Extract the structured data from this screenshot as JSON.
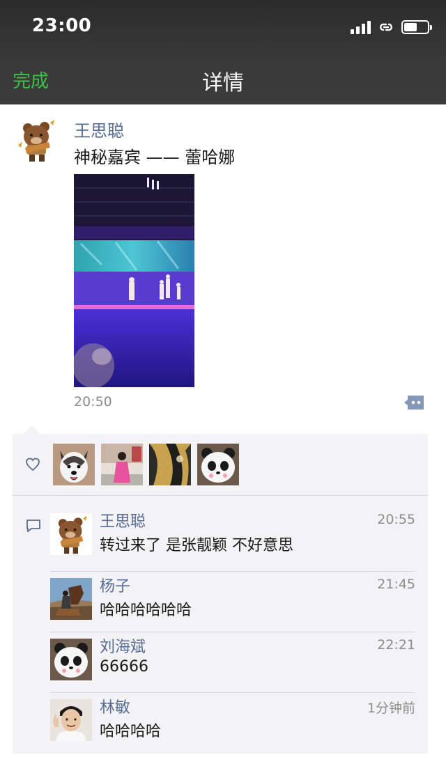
{
  "status_bar": {
    "time": "23:00",
    "icons": [
      "cellular-signal-icon",
      "hotspot-link-icon",
      "battery-icon"
    ],
    "battery_level": 0.55
  },
  "nav": {
    "done_label": "完成",
    "title": "详情"
  },
  "colors": {
    "bar_background": "#3a3a3a",
    "done_green": "#3cc246",
    "name_blue": "#576b95",
    "panel_background": "#f3f3f5"
  },
  "post": {
    "author": "王思聪",
    "text": "神秘嘉宾 —— 蕾哈娜",
    "time": "20:50",
    "more_icon": "comment-more-icon"
  },
  "likes": {
    "icon": "heart-outline-icon",
    "users": [
      {
        "avatar": "husky-dog-avatar"
      },
      {
        "avatar": "woman-pink-dress-avatar"
      },
      {
        "avatar": "dark-abstract-avatar"
      },
      {
        "avatar": "panda-avatar"
      }
    ]
  },
  "comments": {
    "icon": "speech-bubble-icon",
    "items": [
      {
        "name": "王思聪",
        "time": "20:55",
        "text": "转过来了 是张靓颖 不好意思",
        "avatar": "brown-bear-avatar"
      },
      {
        "name": "杨子",
        "time": "21:45",
        "text": "哈哈哈哈哈哈",
        "avatar": "horse-rider-avatar"
      },
      {
        "name": "刘海斌",
        "time": "22:21",
        "text": "66666",
        "avatar": "panda-avatar"
      },
      {
        "name": "林敏",
        "time": "1分钟前",
        "text": "哈哈哈哈",
        "avatar": "man-peace-sign-avatar"
      }
    ]
  }
}
